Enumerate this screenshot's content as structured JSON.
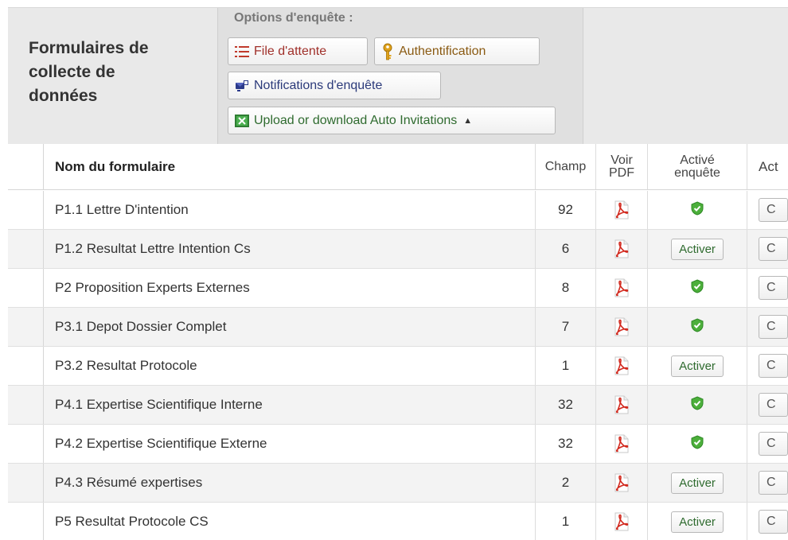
{
  "header": {
    "title_lines": [
      "Formulaires de",
      "collecte de",
      "données"
    ],
    "options_label": "Options d'enquête :",
    "buttons": {
      "file_attente": "File d'attente",
      "authentification": "Authentification",
      "notifications": "Notifications d'enquête",
      "upload": "Upload or download Auto Invitations"
    }
  },
  "table": {
    "headers": {
      "name": "Nom du formulaire",
      "champ": "Champ",
      "pdf_line1": "Voir",
      "pdf_line2": "PDF",
      "active_line1": "Activé",
      "active_line2": "enquête",
      "last": "Act"
    },
    "rows": [
      {
        "name": "P1.1 Lettre D'intention",
        "champ": "92",
        "active": true,
        "action": "C"
      },
      {
        "name": "P1.2 Resultat Lettre Intention Cs",
        "champ": "6",
        "active": false,
        "activer_label": "Activer",
        "action": "C"
      },
      {
        "name": "P2 Proposition Experts Externes",
        "champ": "8",
        "active": true,
        "action": "C"
      },
      {
        "name": "P3.1 Depot Dossier Complet",
        "champ": "7",
        "active": true,
        "action": "C"
      },
      {
        "name": "P3.2 Resultat Protocole",
        "champ": "1",
        "active": false,
        "activer_label": "Activer",
        "action": "C"
      },
      {
        "name": "P4.1 Expertise Scientifique Interne",
        "champ": "32",
        "active": true,
        "action": "C"
      },
      {
        "name": "P4.2 Expertise Scientifique Externe",
        "champ": "32",
        "active": true,
        "action": "C"
      },
      {
        "name": "P4.3 Résumé expertises",
        "champ": "2",
        "active": false,
        "activer_label": "Activer",
        "action": "C"
      },
      {
        "name": "P5 Resultat Protocole CS",
        "champ": "1",
        "active": false,
        "activer_label": "Activer",
        "action": "C"
      }
    ]
  },
  "colors": {
    "header_bg": "#e9e9e9",
    "row_alt": "#f3f3f3",
    "pdf_red": "#d22a1f",
    "shield_green": "#4caf3b"
  },
  "icons": {
    "file_attente": "list-icon",
    "authentification": "key-icon",
    "notifications": "notification-icon",
    "upload": "excel-icon",
    "pdf": "pdf-icon",
    "active": "shield-check-icon"
  }
}
